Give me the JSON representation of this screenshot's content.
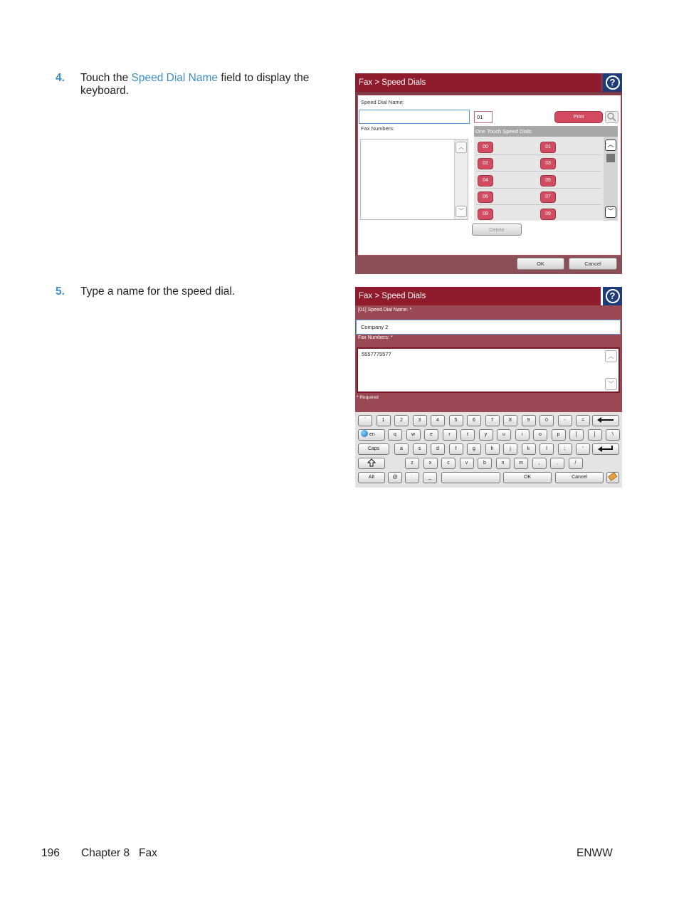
{
  "steps": [
    {
      "number": "4.",
      "text_before": "Touch the ",
      "link": "Speed Dial Name",
      "text_after": " field to display the keyboard."
    },
    {
      "number": "5.",
      "text": "Type a name for the speed dial."
    }
  ],
  "screen1": {
    "title": "Fax > Speed Dials",
    "help_icon": "?",
    "speed_dial_name_label": "Speed Dial Name:",
    "speed_dial_name_value": "",
    "number_value": "01",
    "print_label": "Print",
    "fax_numbers_label": "Fax Numbers:",
    "one_touch_label": "One Touch Speed Dials",
    "dials": [
      "00",
      "01",
      "02",
      "03",
      "04",
      "05",
      "06",
      "07",
      "08",
      "09"
    ],
    "delete_label": "Delete",
    "ok_label": "OK",
    "cancel_label": "Cancel"
  },
  "screen2": {
    "title": "Fax > Speed Dials",
    "help_icon": "?",
    "name_label": "[01] Speed Dial Name: *",
    "name_value": "Company 2",
    "fax_numbers_label": "Fax Numbers: *",
    "fax_numbers_value": "5557775577",
    "required_label": "* Required",
    "keyboard": {
      "row1": [
        "`",
        "1",
        "2",
        "3",
        "4",
        "5",
        "6",
        "7",
        "8",
        "9",
        "0",
        "-",
        "="
      ],
      "row2": [
        "q",
        "w",
        "e",
        "r",
        "t",
        "y",
        "u",
        "i",
        "o",
        "p",
        "[",
        "]",
        "\\"
      ],
      "row3": [
        "a",
        "s",
        "d",
        "f",
        "g",
        "h",
        "j",
        "k",
        "l",
        ";",
        "'"
      ],
      "row4": [
        "z",
        "x",
        "c",
        "v",
        "b",
        "n",
        "m",
        ",",
        ".",
        "/"
      ],
      "lang_label": "en",
      "caps_label": "Caps",
      "alt_label": "Alt",
      "at_label": "@",
      "dot_label": ".",
      "underscore_label": "_",
      "ok_label": "OK",
      "cancel_label": "Cancel"
    }
  },
  "footer": {
    "page_number": "196",
    "chapter": "Chapter 8   Fax",
    "right": "ENWW"
  },
  "colors": {
    "accent_blue": "#3a8dc6",
    "title_bar": "#8f1b2c",
    "help_blue": "#1f3c7a",
    "dial_red": "#d24b60"
  }
}
